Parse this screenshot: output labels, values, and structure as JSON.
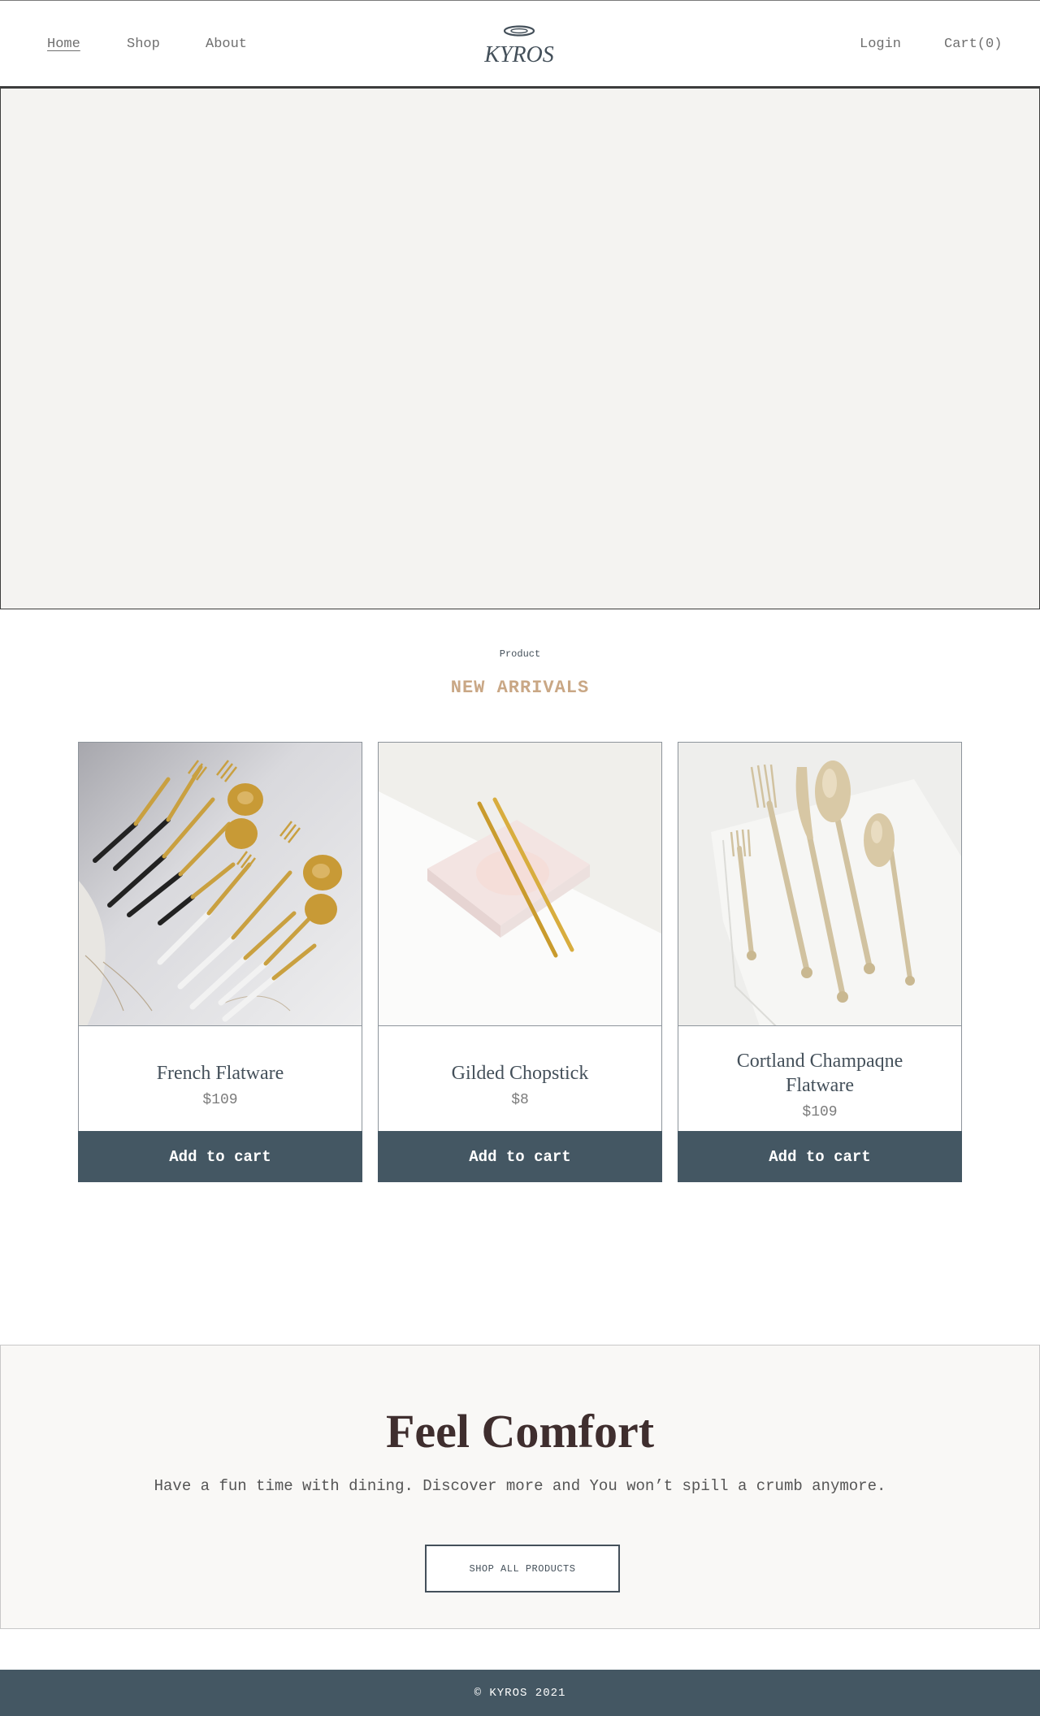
{
  "nav": {
    "left": [
      {
        "label": "Home",
        "active": true
      },
      {
        "label": "Shop",
        "active": false
      },
      {
        "label": "About",
        "active": false
      }
    ],
    "logo_text": "KYROS",
    "login": "Login",
    "cart": "Cart(0)"
  },
  "arrivals": {
    "eyebrow": "Product",
    "title": "NEW ARRIVALS",
    "products": [
      {
        "name": "French Flatware",
        "price": "$109",
        "button": "Add to cart"
      },
      {
        "name": "Gilded Chopstick",
        "price": "$8",
        "button": "Add to cart"
      },
      {
        "name": "Cortland Champaqne Flatware",
        "price": "$109",
        "button": "Add to cart"
      }
    ]
  },
  "promo": {
    "title": "Feel Comfort",
    "text": "Have a fun time with dining. Discover more and You won’t spill a crumb anymore.",
    "button": "SHOP ALL PRODUCTS"
  },
  "footer": {
    "copyright": "© KYROS 2021"
  },
  "colors": {
    "primary": "#445763",
    "accent": "#c9a785",
    "hero_bg": "#f4f3f1",
    "promo_bg": "#f9f8f6",
    "promo_title": "#3f2e2e"
  }
}
